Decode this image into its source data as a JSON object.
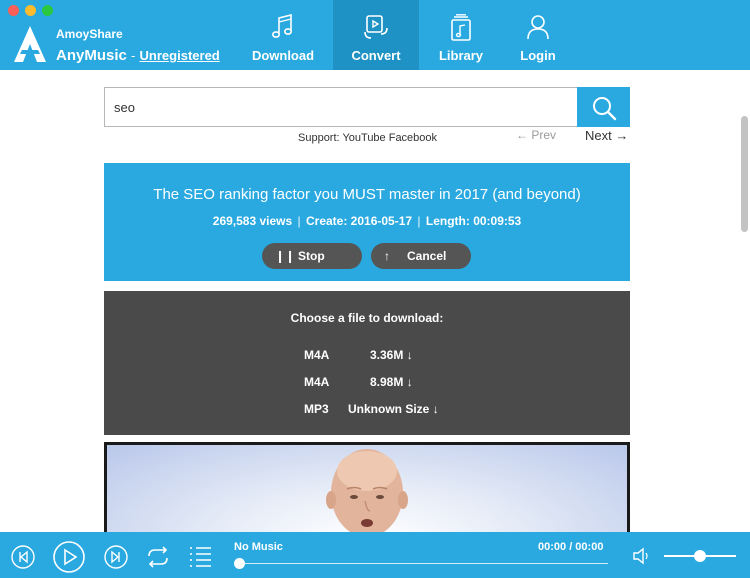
{
  "window": {
    "traffic_lights": [
      "close",
      "minimize",
      "zoom"
    ]
  },
  "brand": {
    "company": "AmoyShare",
    "product": "AnyMusic",
    "separator": "-",
    "status": "Unregistered"
  },
  "nav": [
    {
      "label": "Download",
      "icon": "music-note-icon",
      "active": false
    },
    {
      "label": "Convert",
      "icon": "convert-icon",
      "active": true
    },
    {
      "label": "Library",
      "icon": "library-icon",
      "active": false
    },
    {
      "label": "Login",
      "icon": "user-icon",
      "active": false
    }
  ],
  "search": {
    "value": "seo",
    "button_icon": "search-icon"
  },
  "support": {
    "text": "Support: YouTube Facebook"
  },
  "pagination": {
    "prev": "Prev",
    "next": "Next"
  },
  "video": {
    "title": "The SEO ranking factor you MUST master in 2017 (and beyond)",
    "views": "269,583 views",
    "create": "Create: 2016-05-17",
    "length": "Length: 00:09:53",
    "sep": "|"
  },
  "actions": {
    "stop": "Stop",
    "cancel": "Cancel"
  },
  "download": {
    "heading": "Choose a file to download:",
    "files": [
      {
        "format": "M4A",
        "size": "3.36M"
      },
      {
        "format": "M4A",
        "size": "8.98M"
      },
      {
        "format": "MP3",
        "size": "Unknown Size"
      }
    ]
  },
  "player": {
    "now_playing": "No Music",
    "time": "00:00 / 00:00",
    "progress": 0,
    "volume": 0.5
  },
  "colors": {
    "accent": "#29a9e0",
    "active_nav": "#1e92c4",
    "panel_dark": "#4a4a4a",
    "pill": "#555555"
  }
}
